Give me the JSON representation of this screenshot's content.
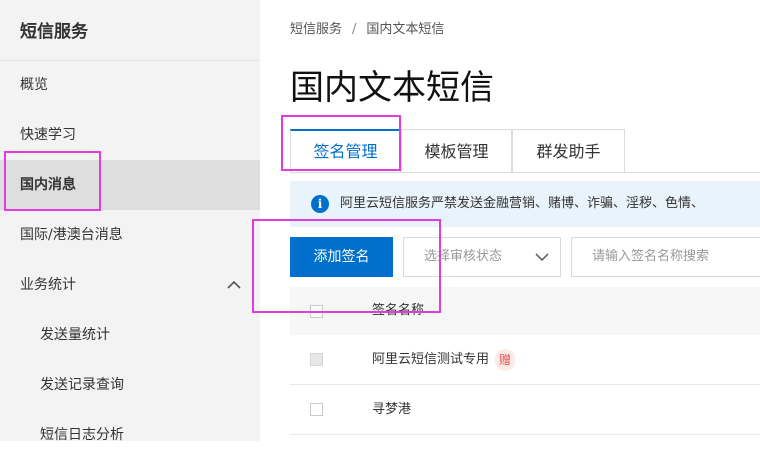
{
  "sidebar": {
    "title": "短信服务",
    "items": [
      {
        "label": "概览"
      },
      {
        "label": "快速学习"
      },
      {
        "label": "国内消息"
      },
      {
        "label": "国际/港澳台消息"
      },
      {
        "label": "业务统计"
      },
      {
        "label": "发送量统计"
      },
      {
        "label": "发送记录查询"
      },
      {
        "label": "短信日志分析"
      }
    ],
    "active_item": "国内消息",
    "expand_icon": "chevron-up-icon"
  },
  "breadcrumb": {
    "items": [
      "短信服务",
      "国内文本短信"
    ],
    "separator": "/"
  },
  "page": {
    "title": "国内文本短信"
  },
  "tabs": [
    {
      "label": "签名管理",
      "active": true
    },
    {
      "label": "模板管理",
      "active": false
    },
    {
      "label": "群发助手",
      "active": false
    }
  ],
  "notice": {
    "icon": "info-icon",
    "icon_glyph": "i",
    "text": "阿里云短信服务严禁发送金融营销、赌博、诈骗、淫秽、色情、"
  },
  "toolbar": {
    "add_label": "添加签名",
    "status_select_value": "选择审核状态",
    "search_placeholder": "请输入签名名称搜索"
  },
  "table": {
    "columns": [
      "签名名称"
    ],
    "rows": [
      {
        "name": "阿里云短信测试专用",
        "tag": "赠",
        "checkbox_disabled": true
      },
      {
        "name": "寻梦港",
        "tag": "",
        "checkbox_disabled": false
      }
    ]
  },
  "colors": {
    "accent": "#0070cc",
    "highlight": "#e23be0",
    "sidebar_bg": "#f3f3f3",
    "notice_bg": "#e8f3fb",
    "tag_text": "#e5564f"
  }
}
